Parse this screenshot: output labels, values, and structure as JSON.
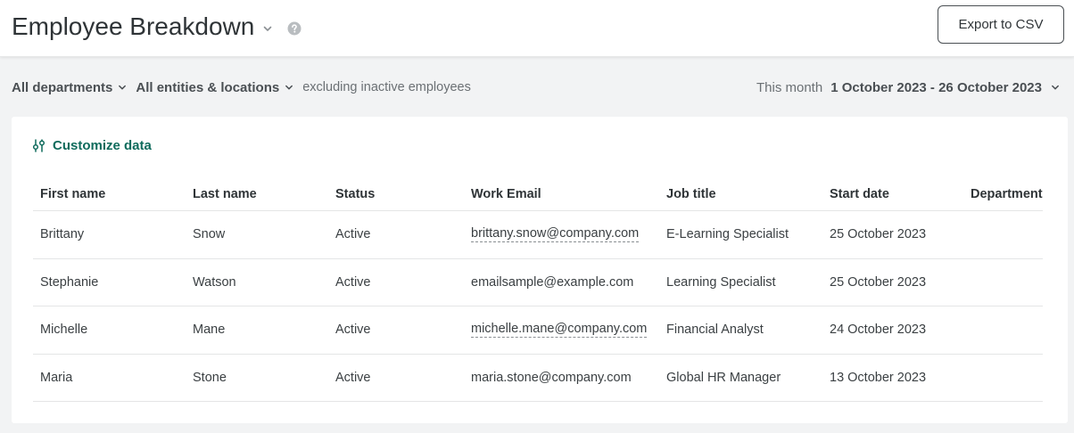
{
  "header": {
    "title": "Employee Breakdown",
    "export_label": "Export to CSV"
  },
  "filters": {
    "departments": "All departments",
    "entities": "All entities & locations",
    "note": "excluding inactive employees"
  },
  "date_range": {
    "label": "This month",
    "value": "1 October 2023 - 26 October 2023"
  },
  "card": {
    "customize_label": "Customize data"
  },
  "table": {
    "columns": [
      "First name",
      "Last name",
      "Status",
      "Work Email",
      "Job title",
      "Start date",
      "Department"
    ],
    "rows": [
      {
        "first": "Brittany",
        "last": "Snow",
        "status": "Active",
        "email": "brittany.snow@company.com",
        "email_linked": true,
        "job": "E-Learning Specialist",
        "start": "25 October 2023",
        "dept": ""
      },
      {
        "first": "Stephanie",
        "last": "Watson",
        "status": "Active",
        "email": "emailsample@example.com",
        "email_linked": false,
        "job": "Learning Specialist",
        "start": "25 October 2023",
        "dept": ""
      },
      {
        "first": "Michelle",
        "last": "Mane",
        "status": "Active",
        "email": "michelle.mane@company.com",
        "email_linked": true,
        "job": "Financial Analyst",
        "start": "24 October 2023",
        "dept": ""
      },
      {
        "first": "Maria",
        "last": "Stone",
        "status": "Active",
        "email": "maria.stone@company.com",
        "email_linked": false,
        "job": "Global HR Manager",
        "start": "13 October 2023",
        "dept": ""
      }
    ]
  },
  "colors": {
    "accent": "#0f6b5c",
    "background": "#f2f3f4",
    "text": "#2f3437"
  },
  "icons": {
    "title_dropdown": "chevron-down-icon",
    "help": "help-icon",
    "filter_dropdown": "chevron-down-icon",
    "customize": "sliders-icon"
  }
}
